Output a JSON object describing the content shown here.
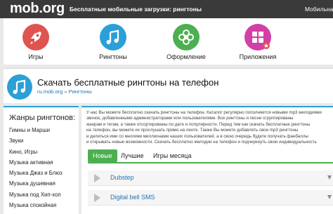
{
  "header": {
    "logo": "mob.org",
    "tagline": "Бесплатные мобильные загрузки: рингтоны",
    "right_label": "Мобильна"
  },
  "categories": [
    {
      "label": "Игры",
      "icon": "rocket-icon",
      "color": "#e0544f"
    },
    {
      "label": "Рингтоны",
      "icon": "music-note-icon",
      "color": "#2aa0d6"
    },
    {
      "label": "Оформление",
      "icon": "flower-icon",
      "color": "#4caf50"
    },
    {
      "label": "Приложения",
      "icon": "apps-grid-icon",
      "color": "#d23fa6"
    }
  ],
  "page": {
    "title": "Скачать бесплатные рингтоны на телефон",
    "breadcrumb": {
      "home": "ru.mob.org",
      "separator": "»",
      "current": "Рингтоны"
    }
  },
  "sidebar": {
    "title": "Жанры рингтонов:",
    "items": [
      "Гимны и Марши",
      "Звуки",
      "Кино, Игры",
      "Музыка активная",
      "Музыка Джаз и Блюз",
      "Музыка душевная",
      "Музыка под Хип-хоп",
      "Музыка спокойная"
    ]
  },
  "intro_lines": [
    "У нас Вы можете бесплатно скачать рингтоны на телефон. Каталог регулярно пополняется новыми mp3 мелодиями",
    "звонок, добавленными администраторами или пользователями. Все рингтоны и песни сгруппированы",
    "жанрам и тегам, а также отсортированы по дате и популярности. Перед тем как скачать бесплатные рингтоны",
    "на телефон, вы можете их прослушать прямо на ленте. Также Вы можете добавлять свои mp3 рингтоны",
    "и делиться ими со многими миллионами наших пользователей, а в свою очередь будете получать фанбаллы",
    "и открывать новые возможности. Скачать бесплатно мелодии на телефон и подчеркнуть свою индивидуальность"
  ],
  "tabs": {
    "new": "Новые",
    "best": "Лучшие",
    "month": "Игры месяца"
  },
  "tracks": [
    "Dubstep",
    "Digital bell SMS"
  ]
}
